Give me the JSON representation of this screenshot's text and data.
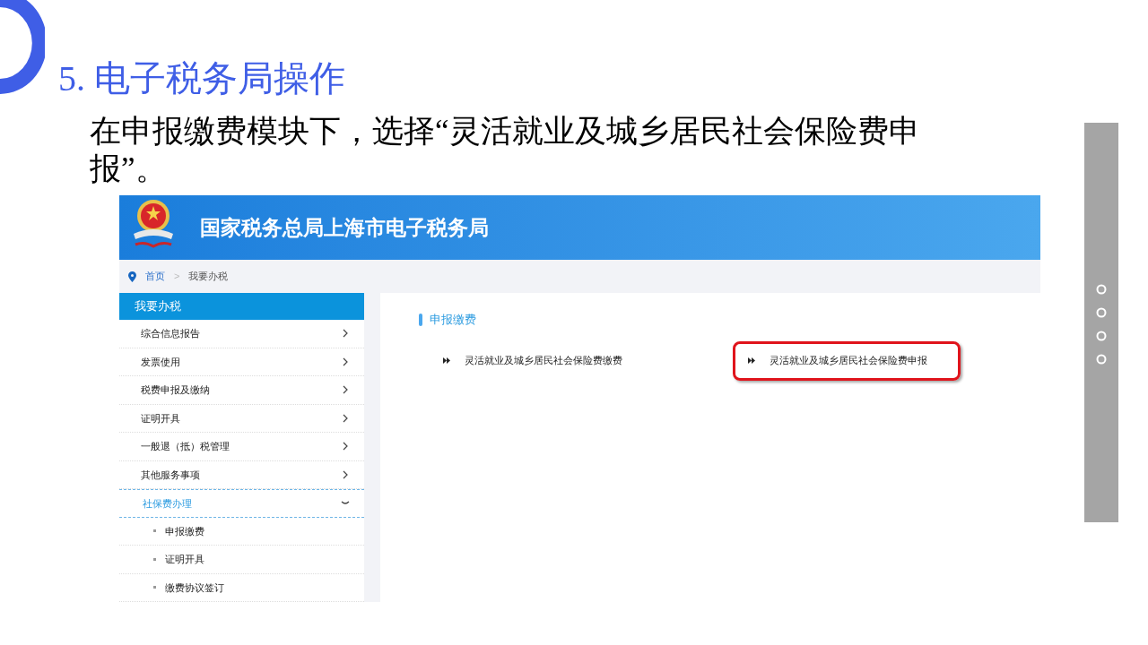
{
  "slide": {
    "title": "5. 电子税务局操作",
    "body": "在申报缴费模块下，选择“灵活就业及城乡居民社会保险费申报”。"
  },
  "site": {
    "title": "国家税务总局上海市电子税务局",
    "breadcrumb_separator": ">",
    "breadcrumb": [
      {
        "label": "首页",
        "selected": false
      },
      {
        "label": "我要办税",
        "selected": true
      }
    ],
    "sidebar": {
      "header": "我要办税",
      "items": [
        {
          "label": "综合信息报告",
          "expanded": false
        },
        {
          "label": "发票使用",
          "expanded": false
        },
        {
          "label": "税费申报及缴纳",
          "expanded": false
        },
        {
          "label": "证明开具",
          "expanded": false
        },
        {
          "label": "一般退（抵）税管理",
          "expanded": false
        },
        {
          "label": "其他服务事项",
          "expanded": false
        },
        {
          "label": "社保费办理",
          "expanded": true,
          "children": [
            {
              "label": "申报缴费"
            },
            {
              "label": "证明开具"
            },
            {
              "label": "缴费协议签订"
            }
          ]
        }
      ]
    },
    "section": {
      "title": "申报缴费",
      "links": [
        {
          "label": "灵活就业及城乡居民社会保险费缴费",
          "highlighted": false
        },
        {
          "label": "灵活就业及城乡居民社会保险费申报",
          "highlighted": true
        }
      ]
    }
  }
}
